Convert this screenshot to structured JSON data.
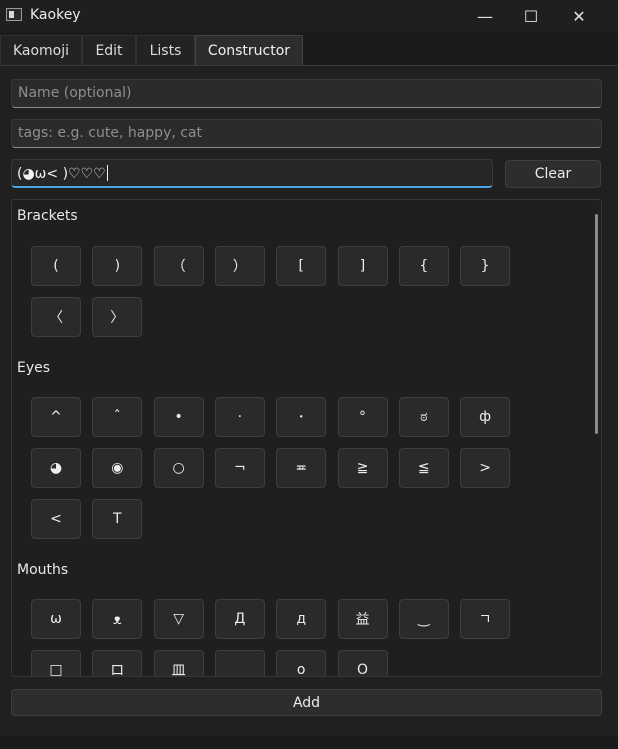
{
  "window": {
    "title": "Kaokey",
    "minimize_glyph": "—",
    "maximize_glyph": "☐",
    "close_glyph": "✕"
  },
  "tabs": [
    {
      "label": "Kaomoji",
      "active": false
    },
    {
      "label": "Edit",
      "active": false
    },
    {
      "label": "Lists",
      "active": false
    },
    {
      "label": "Constructor",
      "active": true
    }
  ],
  "form": {
    "name_placeholder": "Name (optional)",
    "tags_placeholder": "tags: e.g. cute, happy, cat",
    "compose_value": "(◕ω< )♡♡♡",
    "clear_label": "Clear",
    "add_label": "Add"
  },
  "sections": [
    {
      "title": "Brackets",
      "keys": [
        "(",
        ")",
        "（",
        "）",
        "[",
        "]",
        "{",
        "}",
        "〈",
        "〉"
      ]
    },
    {
      "title": "Eyes",
      "keys": [
        "^",
        "ˆ",
        "•",
        "·",
        "･",
        "°",
        "ಠ",
        "ф",
        "◕",
        "◉",
        "○",
        "¬",
        "≖",
        "≧",
        "≦",
        ">",
        "<",
        "T"
      ]
    },
    {
      "title": "Mouths",
      "keys": [
        "ω",
        "ᴥ",
        "▽",
        "Д",
        "д",
        "益",
        "‿",
        "ㄱ",
        "□",
        "ロ",
        "皿",
        "",
        "o",
        "O"
      ]
    }
  ]
}
